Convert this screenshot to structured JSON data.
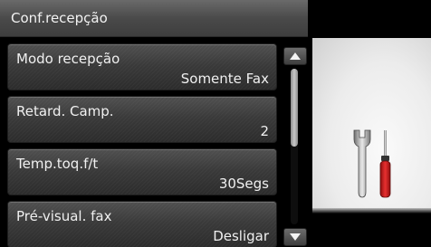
{
  "header": {
    "title": "Conf.recepção"
  },
  "menu": {
    "items": [
      {
        "label": "Modo recepção",
        "value": "Somente Fax"
      },
      {
        "label": "Retard. Camp.",
        "value": "2"
      },
      {
        "label": "Temp.toq.f/t",
        "value": "30Segs"
      },
      {
        "label": "Pré-visual. fax",
        "value": "Desligar"
      }
    ]
  },
  "scroll": {
    "position_fraction": 0.0,
    "visible_fraction": 0.5
  },
  "icons": {
    "up": "chevron-up-icon",
    "down": "chevron-down-icon",
    "tools": "tools-icon"
  },
  "colors": {
    "header": "#4a4a4a",
    "text": "#f0f0f0",
    "panel": "#ececec",
    "screwdriver_handle": "#d42020"
  }
}
